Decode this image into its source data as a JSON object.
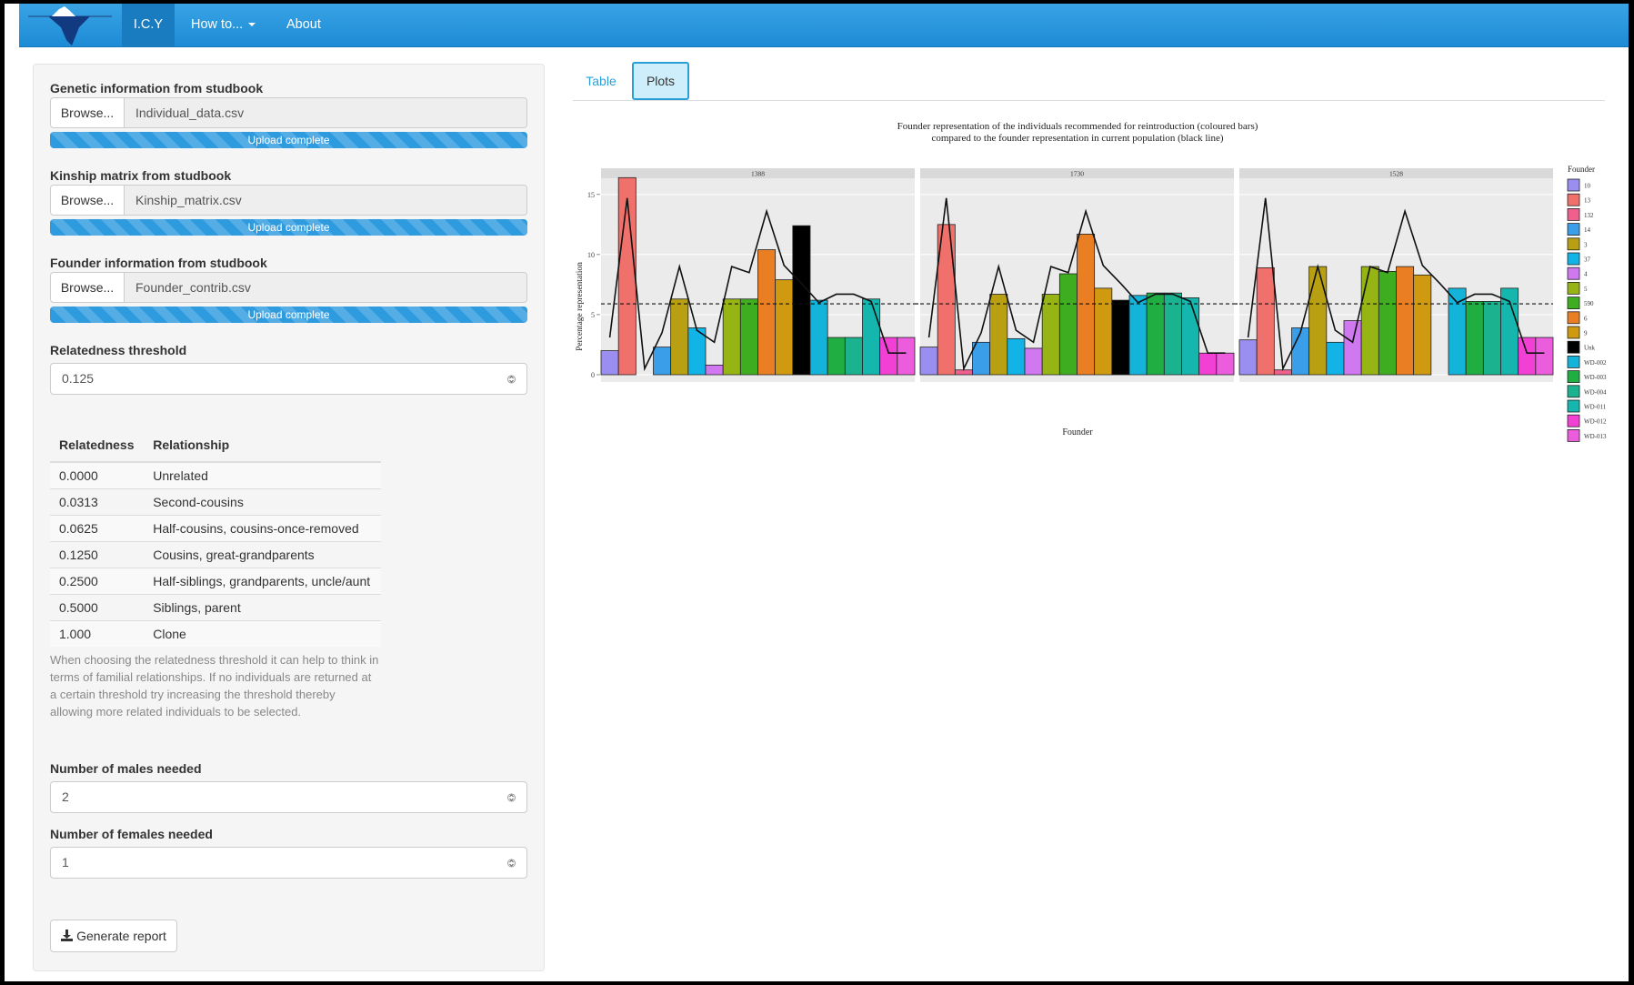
{
  "navbar": {
    "brand_icon": "iceberg-logo",
    "items": [
      {
        "label": "I.C.Y",
        "active": true
      },
      {
        "label": "How to...",
        "dropdown": true
      },
      {
        "label": "About"
      }
    ],
    "color": "#2a9fd6"
  },
  "sidebar": {
    "uploads": [
      {
        "label": "Genetic information from studbook",
        "button": "Browse...",
        "file": "Individual_data.csv",
        "status": "Upload complete",
        "progress": 1.0
      },
      {
        "label": "Kinship matrix from studbook",
        "button": "Browse...",
        "file": "Kinship_matrix.csv",
        "status": "Upload complete",
        "progress": 1.0
      },
      {
        "label": "Founder information from studbook",
        "button": "Browse...",
        "file": "Founder_contrib.csv",
        "status": "Upload complete",
        "progress": 1.0
      }
    ],
    "threshold": {
      "label": "Relatedness threshold",
      "value": "0.125"
    },
    "relatedness_table": {
      "headers": [
        "Relatedness",
        "Relationship"
      ],
      "rows": [
        [
          "0.0000",
          "Unrelated"
        ],
        [
          "0.0313",
          "Second-cousins"
        ],
        [
          "0.0625",
          "Half-cousins, cousins-once-removed"
        ],
        [
          "0.1250",
          "Cousins, great-grandparents"
        ],
        [
          "0.2500",
          "Half-siblings, grandparents, uncle/aunt"
        ],
        [
          "0.5000",
          "Siblings, parent"
        ],
        [
          "1.000",
          "Clone"
        ]
      ]
    },
    "help_text": "When choosing the relatedness threshold it can help to think in terms of familial relationships. If no individuals are returned at a certain threshold try increasing the threshold thereby allowing more related individuals to be selected.",
    "males": {
      "label": "Number of males needed",
      "value": "2"
    },
    "females": {
      "label": "Number of females needed",
      "value": "1"
    },
    "generate_button": "Generate report",
    "generate_icon": "download-icon"
  },
  "tabs": [
    {
      "label": "Table",
      "active": false
    },
    {
      "label": "Plots",
      "active": true
    }
  ],
  "chart_data": {
    "type": "bar",
    "title": "Founder representation of the individuals recommended for reintroduction (coloured bars)",
    "subtitle": "compared to the founder representation in current population (black line)",
    "xlabel": "Founder",
    "ylabel": "Percentage representation",
    "ylim": [
      0,
      16.5
    ],
    "yticks": [
      0,
      5,
      10,
      15
    ],
    "reference_line": 5.9,
    "legend_title": "Founder",
    "legend_position": "right",
    "categories": [
      "10",
      "13",
      "132",
      "14",
      "3",
      "37",
      "4",
      "5",
      "590",
      "6",
      "9",
      "Unk",
      "WD-002",
      "WD-003",
      "WD-004",
      "WD-011",
      "WD-012",
      "WD-013"
    ],
    "colors": [
      "#9a8ff0",
      "#f0716b",
      "#f0608f",
      "#3a9ee8",
      "#b9a012",
      "#12b4e8",
      "#cf78f0",
      "#96b414",
      "#3fad20",
      "#e97e23",
      "#cf9a10",
      "#000000",
      "#14b3d9",
      "#20ae43",
      "#1bb38f",
      "#15b6ae",
      "#f23fd4",
      "#ec5dde"
    ],
    "population_line": [
      3.1,
      14.7,
      0.5,
      3.5,
      9.0,
      3.7,
      2.7,
      9.0,
      8.5,
      13.6,
      9.1,
      7.6,
      6.0,
      6.7,
      6.7,
      6.1,
      1.8,
      1.8
    ],
    "panels": [
      {
        "name": "1388",
        "values": [
          2.0,
          16.4,
          0,
          2.3,
          6.3,
          3.9,
          0.8,
          6.3,
          6.3,
          10.4,
          7.9,
          12.4,
          6.2,
          3.1,
          3.1,
          6.3,
          3.1,
          3.1
        ]
      },
      {
        "name": "1730",
        "values": [
          2.3,
          12.5,
          0.4,
          2.7,
          6.7,
          3.0,
          2.2,
          6.7,
          8.4,
          11.7,
          7.2,
          6.2,
          6.6,
          6.8,
          6.8,
          6.4,
          1.8,
          1.8
        ]
      },
      {
        "name": "1528",
        "values": [
          2.9,
          8.9,
          0.4,
          3.9,
          9.0,
          2.7,
          4.5,
          9.0,
          8.6,
          9.0,
          8.3,
          0,
          7.2,
          6.1,
          6.1,
          7.2,
          3.1,
          3.1
        ]
      }
    ]
  }
}
